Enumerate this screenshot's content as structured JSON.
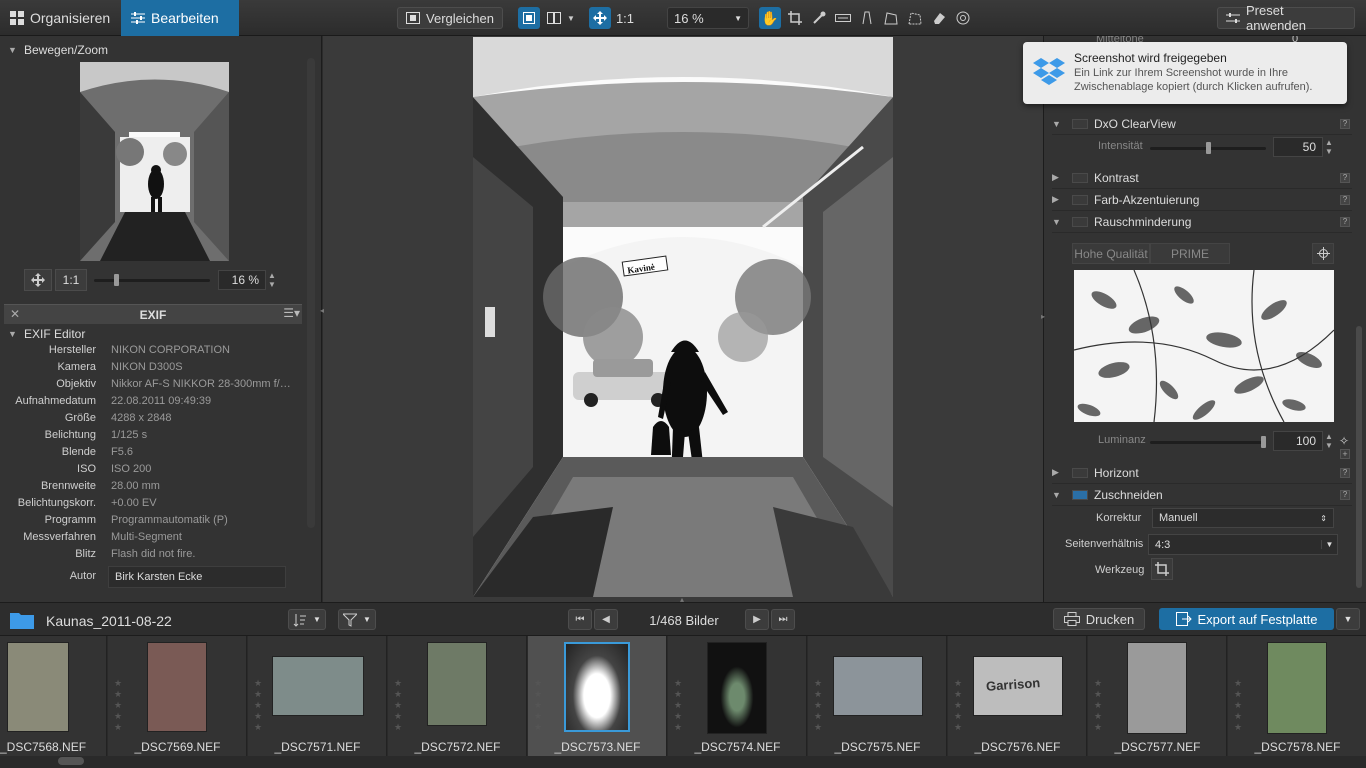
{
  "topbar": {
    "organize_label": "Organisieren",
    "edit_label": "Bearbeiten",
    "compare_label": "Vergleichen",
    "one_to_one": "1:1",
    "zoom_value": "16 %",
    "preset_label": "Preset anwenden"
  },
  "left": {
    "navigator_title": "Bewegen/Zoom",
    "nav_one_to_one": "1:1",
    "nav_zoom": "16 %",
    "exif_panel_title": "EXIF",
    "exif_editor_title": "EXIF Editor",
    "exif_rows": [
      {
        "k": "Hersteller",
        "v": "NIKON CORPORATION"
      },
      {
        "k": "Kamera",
        "v": "NIKON D300S"
      },
      {
        "k": "Objektiv",
        "v": "Nikkor AF-S NIKKOR 28-300mm f/…"
      },
      {
        "k": "Aufnahmedatum",
        "v": "22.08.2011 09:49:39"
      },
      {
        "k": "Größe",
        "v": "4288 x 2848"
      },
      {
        "k": "Belichtung",
        "v": "1/125 s"
      },
      {
        "k": "Blende",
        "v": "F5.6"
      },
      {
        "k": "ISO",
        "v": "ISO 200"
      },
      {
        "k": "Brennweite",
        "v": "28.00 mm"
      },
      {
        "k": "Belichtungskorr.",
        "v": "+0.00 EV"
      },
      {
        "k": "Programm",
        "v": "Programmautomatik (P)"
      },
      {
        "k": "Messverfahren",
        "v": "Multi-Segment"
      },
      {
        "k": "Blitz",
        "v": "Flash did not fire."
      }
    ],
    "author_label": "Autor",
    "author_value": "Birk Karsten Ecke"
  },
  "right": {
    "partial_label": "Mitteltöne",
    "partial_value": "0",
    "notification_title": "Screenshot wird freigegeben",
    "notification_body_line1": "Ein Link zur Ihrem Screenshot wurde in Ihre",
    "notification_body_line2": "Zwischenablage kopiert (durch Klicken aufrufen).",
    "clearview_label": "DxO ClearView",
    "intensity_label": "Intensität",
    "intensity_value": "50",
    "intensity_level": 0.5,
    "contrast_label": "Kontrast",
    "color_accent_label": "Farb-Akzentuierung",
    "noise_label": "Rauschminderung",
    "hq_label": "Hohe Qualität",
    "prime_label": "PRIME",
    "luminance_label": "Luminanz",
    "luminance_value": "100",
    "luminance_level": 1.0,
    "horizon_label": "Horizont",
    "crop_label": "Zuschneiden",
    "correction_label": "Korrektur",
    "correction_value": "Manuell",
    "ratio_label": "Seitenverhältnis",
    "ratio_value": "4:3",
    "tool_label": "Werkzeug"
  },
  "filmhead": {
    "folder_name": "Kaunas_2011-08-22",
    "counter": "1/468 Bilder",
    "print_label": "Drucken",
    "export_label": "Export auf Festplatte"
  },
  "thumbnails": [
    {
      "name": "_DSC7568.NEF"
    },
    {
      "name": "_DSC7569.NEF"
    },
    {
      "name": "_DSC7571.NEF"
    },
    {
      "name": "_DSC7572.NEF"
    },
    {
      "name": "_DSC7573.NEF"
    },
    {
      "name": "_DSC7574.NEF"
    },
    {
      "name": "_DSC7575.NEF"
    },
    {
      "name": "_DSC7576.NEF"
    },
    {
      "name": "_DSC7577.NEF"
    },
    {
      "name": "_DSC7578.NEF"
    }
  ],
  "photo_sign_text": "Kavinė",
  "thumb_sign_text": "Garrison"
}
